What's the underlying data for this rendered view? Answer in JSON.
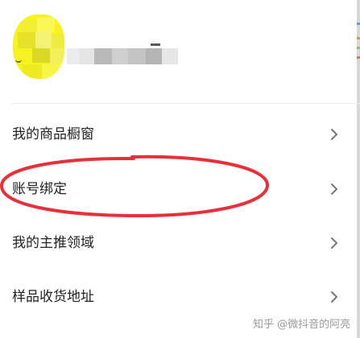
{
  "profile": {
    "avatar_icon": "pixelated-avatar-icon"
  },
  "menu": {
    "items": [
      {
        "label": "我的商品橱窗",
        "icon": "chevron-right-icon"
      },
      {
        "label": "账号绑定",
        "icon": "chevron-right-icon"
      },
      {
        "label": "我的主推领域",
        "icon": "chevron-right-icon"
      },
      {
        "label": "样品收货地址",
        "icon": "chevron-right-icon"
      }
    ]
  },
  "annotation": {
    "color": "#e8303a"
  },
  "watermark": {
    "text": "知乎 @微抖音的阿亮"
  },
  "colors": {
    "background": "#ffffff",
    "text": "#222222",
    "chevron": "#777777",
    "avatar": "#f7f31c"
  }
}
